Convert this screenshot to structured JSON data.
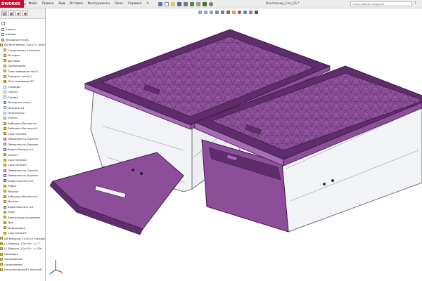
{
  "app": {
    "logo_text": "DWORKS",
    "logo_arrow": "▸"
  },
  "menu": {
    "items": [
      "Файл",
      "Правка",
      "Вид",
      "Вставка",
      "Инструменты",
      "Окно",
      "Справка",
      "✎"
    ]
  },
  "document": {
    "title": "Контейнер_12л_СБ *"
  },
  "search": {
    "placeholder": "Поиск файлов и моделей"
  },
  "feature_tree": {
    "items": [
      {
        "label": "Сверху",
        "icon": "plane"
      },
      {
        "label": "Справа",
        "icon": "plane"
      },
      {
        "label": "Исходная точка",
        "icon": "origin"
      },
      {
        "label": "(б) Контейнер_12л<1> (Конт",
        "icon": "part"
      },
      {
        "label": "Сопряжения в Контей",
        "icon": "folder"
      },
      {
        "label": "История",
        "icon": "folder"
      },
      {
        "label": "Датчики",
        "icon": "folder"
      },
      {
        "label": "Примечания",
        "icon": "folder"
      },
      {
        "label": "Тела поверхности(3)",
        "icon": "folder"
      },
      {
        "label": "Твердые тела(1)",
        "icon": "folder"
      },
      {
        "label": "Пластполимер ПП",
        "icon": "feat"
      },
      {
        "label": "Спереди",
        "icon": "plane"
      },
      {
        "label": "Сверху",
        "icon": "plane"
      },
      {
        "label": "Справа",
        "icon": "plane"
      },
      {
        "label": "Исходная точка",
        "icon": "origin"
      },
      {
        "label": "Плоскость1",
        "icon": "plane"
      },
      {
        "label": "Плоскость2",
        "icon": "plane"
      },
      {
        "label": "Эскиз1",
        "icon": "sketch"
      },
      {
        "label": "Бобышка-Вытянуть1",
        "icon": "feat"
      },
      {
        "label": "Бобышка-Вытянуть2",
        "icon": "feat"
      },
      {
        "label": "Скругление1",
        "icon": "feat"
      },
      {
        "label": "Поверхность-Смести",
        "icon": "surf"
      },
      {
        "label": "Поверхность-Удлини",
        "icon": "surf"
      },
      {
        "label": "Вырез-Вытянуть1",
        "icon": "cut"
      },
      {
        "label": "Уклон1",
        "icon": "feat"
      },
      {
        "label": "Скругление2",
        "icon": "feat"
      },
      {
        "label": "Скругление3",
        "icon": "feat"
      },
      {
        "label": "Поверхность-Смести",
        "icon": "surf"
      },
      {
        "label": "Поверхность-Удлини",
        "icon": "surf"
      },
      {
        "label": "Вырез-Вытянуть2",
        "icon": "cut"
      },
      {
        "label": "Ребро",
        "icon": "feat"
      },
      {
        "label": "Массив",
        "icon": "feat"
      },
      {
        "label": "Бобышка-Вытянуть3",
        "icon": "feat"
      },
      {
        "label": "Массив",
        "icon": "feat"
      },
      {
        "label": "Вырез-Вытянуть3",
        "icon": "cut"
      },
      {
        "label": "Упор",
        "icon": "feat"
      },
      {
        "label": "Зеркальное отражени",
        "icon": "feat"
      },
      {
        "label": "Деа",
        "icon": "feat"
      },
      {
        "label": "Маркировка",
        "icon": "feat"
      },
      {
        "label": "Скругление3",
        "icon": "feat"
      },
      {
        "label": "(б) Крышка_12л<1> (Крышк",
        "icon": "part"
      },
      {
        "label": "(-) Дверца_12л<4> -> (Т",
        "icon": "part"
      },
      {
        "label": "(-) Дверца_12л<2> -> (По",
        "icon": "part"
      },
      {
        "label": "Проводка",
        "icon": "folder"
      },
      {
        "label": "Сопряжение",
        "icon": "folder"
      },
      {
        "label": "Сопряжения",
        "icon": "folder"
      },
      {
        "label": "Концентричный1 (Контей",
        "icon": "folder"
      }
    ]
  },
  "colors": {
    "lid": "#8c4e98",
    "lid_light": "#a86cb5",
    "lid_dark": "#5f2d6c",
    "lid_edge": "#3e1a47",
    "glass": "#f2f3f6",
    "glass_edge": "#707070",
    "brand": "#c8102e"
  }
}
